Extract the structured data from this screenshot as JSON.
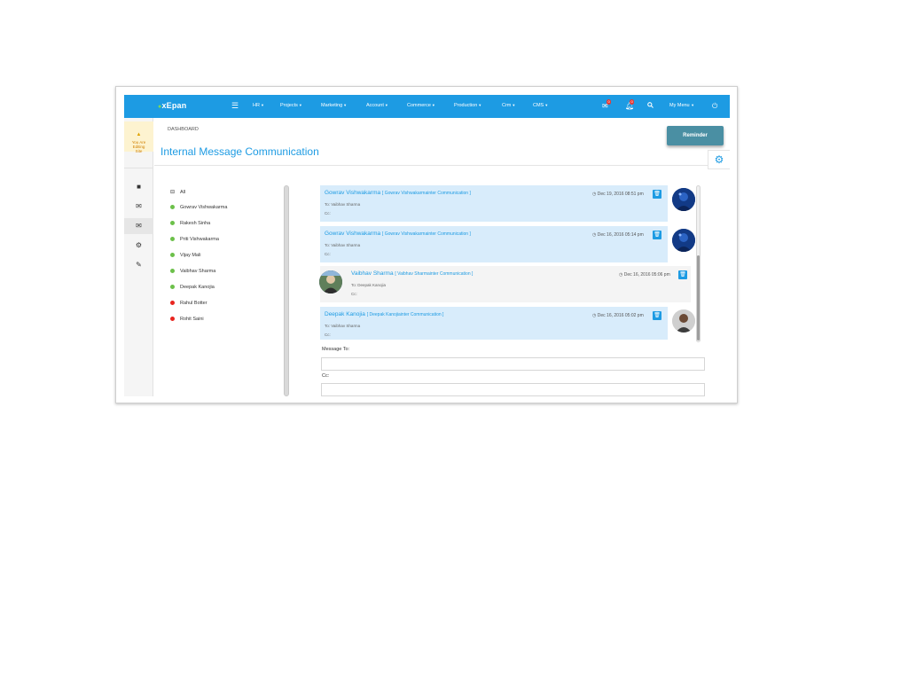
{
  "navbar": {
    "brand": "xEpan",
    "items": [
      {
        "label": "HR"
      },
      {
        "label": "Projects"
      },
      {
        "label": "Marketing"
      },
      {
        "label": "Account"
      },
      {
        "label": "Commerce"
      },
      {
        "label": "Production"
      },
      {
        "label": "Crm"
      },
      {
        "label": "CMS"
      }
    ],
    "mail_badge": "0",
    "bell_badge": "0",
    "user_menu": "My Menu"
  },
  "sidebar": {
    "warning_text": "You Are Editing Site"
  },
  "header": {
    "breadcrumb": "DASHBOARD",
    "title": "Internal Message Communication",
    "reminder_button": "Reminder"
  },
  "contacts": {
    "all_label": "All",
    "items": [
      {
        "name": "Gowrav Vishwakarma",
        "status": "online"
      },
      {
        "name": "Rakesh Sinha",
        "status": "online"
      },
      {
        "name": "Priti Vishwakarma",
        "status": "online"
      },
      {
        "name": "Vijay Mali",
        "status": "online"
      },
      {
        "name": "Vaibhav Sharma",
        "status": "online"
      },
      {
        "name": "Deepak Kanojia",
        "status": "online"
      },
      {
        "name": "Rahul Botter",
        "status": "offline"
      },
      {
        "name": "Rohit Saini",
        "status": "offline"
      }
    ]
  },
  "messages": [
    {
      "sender": "Gowrav Vishwakarma",
      "context": "[ Gowrav Vishwakarmainter Communication ]",
      "to": "To: Vaibhav Sharma",
      "cc": "Cc:",
      "time": "Dec 19, 2016 08:51 pm",
      "side": "right"
    },
    {
      "sender": "Gowrav Vishwakarma",
      "context": "[ Gowrav Vishwakarmainter Communication ]",
      "to": "To: Vaibhav Sharma",
      "cc": "Cc:",
      "time": "Dec 16, 2016 05:14 pm",
      "side": "right"
    },
    {
      "sender": "Vaibhav Sharma",
      "context": "[ Vaibhav Sharmainter Communication ]",
      "to": "To: Deepak Kanojia",
      "cc": "Cc:",
      "time": "Dec 16, 2016 05:06 pm",
      "side": "left"
    },
    {
      "sender": "Deepak Kanojia",
      "context": "[ Deepak Kanojiainter Communication ]",
      "to": "To: Vaibhav Sharma",
      "cc": "Cc:",
      "time": "Dec 16, 2016 05:02 pm",
      "side": "right"
    }
  ],
  "composer": {
    "to_label": "Message To:",
    "cc_label": "Cc:"
  },
  "colors": {
    "accent": "#1d9be3",
    "online": "#6cc04a",
    "offline": "#e8251f",
    "reminder": "#4a8fa3"
  }
}
